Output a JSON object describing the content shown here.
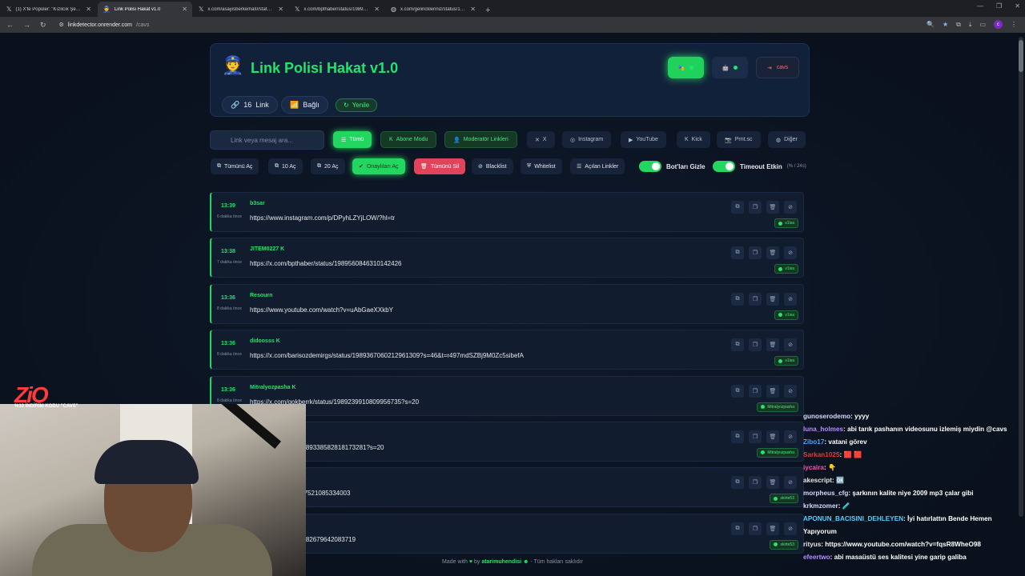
{
  "browser": {
    "tabs": [
      {
        "label": "(1) X'te Popüler: \"Kızılcık Şerbe...",
        "icon": "x-icon",
        "active": false
      },
      {
        "label": "Link Polisi Hakat v1.0",
        "icon": "police-icon",
        "active": true
      },
      {
        "label": "x.com/asayisberkemal0/status/...",
        "icon": "x-icon",
        "active": false
      },
      {
        "label": "x.com/bpthaber/status/198948...",
        "icon": "x-icon",
        "active": false
      },
      {
        "label": "x.com/gelinckleriniz/status/19...",
        "icon": "globe-icon",
        "active": false
      }
    ],
    "url_host": "linkdetector.onrender.com",
    "url_path": "/cavs"
  },
  "header": {
    "title": "Link Polisi Hakat v1.0",
    "link_count": "16",
    "link_label": "Link",
    "status": "Bağlı",
    "refresh": "Yenile",
    "logout": "cavs"
  },
  "search": {
    "placeholder": "Link veya mesaj ara..."
  },
  "filters": [
    {
      "label": "Tümü",
      "style": "on",
      "icon": "list-icon"
    },
    {
      "label": "Abone Modu",
      "style": "gr",
      "icon": "k-icon"
    },
    {
      "label": "Moderatör Linkleri",
      "style": "gr",
      "icon": "user-icon"
    },
    {
      "label": "X",
      "style": "",
      "icon": "x-icon"
    },
    {
      "label": "Instagram",
      "style": "",
      "icon": "instagram-icon"
    },
    {
      "label": "YouTube",
      "style": "",
      "icon": "youtube-icon"
    },
    {
      "label": "Kick",
      "style": "",
      "icon": "kick-icon"
    },
    {
      "label": "Prnt.sc",
      "style": "",
      "icon": "camera-icon"
    },
    {
      "label": "Diğer",
      "style": "",
      "icon": "globe-icon"
    }
  ],
  "actions": [
    {
      "label": "Tümünü Aç",
      "style": "",
      "icon": "open-icon"
    },
    {
      "label": "10 Aç",
      "style": "",
      "icon": "open-icon"
    },
    {
      "label": "20 Aç",
      "style": "",
      "icon": "open-icon"
    },
    {
      "label": "Onaylıları Aç",
      "style": "green",
      "icon": "check-icon"
    },
    {
      "label": "Tümünü Sil",
      "style": "red",
      "icon": "trash-icon"
    },
    {
      "label": "Blacklist",
      "style": "",
      "icon": "ban-icon"
    },
    {
      "label": "Whitelist",
      "style": "",
      "icon": "shield-icon"
    },
    {
      "label": "Açılan Linkler",
      "style": "",
      "icon": "list-icon"
    }
  ],
  "toggles": [
    {
      "label": "Bot'ları Gizle",
      "sub": ""
    },
    {
      "label": "Timeout Etkin",
      "sub": "(% / 24s)"
    }
  ],
  "links": [
    {
      "time": "13:39",
      "ago": "6 dakika önce",
      "user": "b3sar",
      "badge": "",
      "url": "https://www.instagram.com/p/DPyhLZYjLOW/?hl=tr",
      "tag": "v1isa"
    },
    {
      "time": "13:38",
      "ago": "7 dakika önce",
      "user": "JITEM0227",
      "badge": "K",
      "url": "https://x.com/bpthaber/status/1989560846310142426",
      "tag": "v1isa"
    },
    {
      "time": "13:36",
      "ago": "8 dakika önce",
      "user": "Resourn",
      "badge": "",
      "url": "https://www.youtube.com/watch?v=uAbGaeXXkbY",
      "tag": "v1isa"
    },
    {
      "time": "13:36",
      "ago": "8 dakika önce",
      "user": "didoosss",
      "badge": "K",
      "url": "https://x.com/barisozdemirgs/status/1989367060212961309?s=46&t=r497mdSZBj9M0Zc5sibefA",
      "tag": "v1isa"
    },
    {
      "time": "13:36",
      "ago": "8 dakika önce",
      "user": "Mitralyozpasha",
      "badge": "K",
      "url": "https://x.com/gokberrk/status/1989239910809956735?s=20",
      "tag": "Mitralyozpasha"
    },
    {
      "time": "",
      "ago": "",
      "user": "",
      "badge": "",
      "url": "webhaber/status/1989338582818173281?s=20",
      "tag": "Mitralyozpasha"
    },
    {
      "time": "",
      "ago": "",
      "user": "",
      "badge": "",
      "url": "oglu/status/1989587521085334003",
      "tag": "skirte53"
    },
    {
      "time": "",
      "ago": "",
      "user": "",
      "badge": "",
      "url": "icomtr/status/1989582679642083719",
      "tag": "skirte53"
    }
  ],
  "footer": {
    "made": "Made with",
    "by": "by",
    "author": "atarimuhendisi",
    "rights": "- Tüm hakları saklıdır"
  },
  "overlay": {
    "brand": "ZiO",
    "brand_sub": "%10 İNDİRİM KODU \"CAVS\""
  },
  "chat": [
    {
      "name": "gunoserodemo",
      "color": "#d9d9ff",
      "text": ": yyyy"
    },
    {
      "name": "luna_holmes",
      "color": "#b88cff",
      "text": ": abi tarık pashanın videosunu izlemiş miydin @cavs"
    },
    {
      "name": "Zibo17",
      "color": "#4aa3ff",
      "text": ": vatani görev"
    },
    {
      "name": "Sarkan1025",
      "color": "#e23b3b",
      "text": ": 🟥 🟥"
    },
    {
      "name": "iycaira",
      "color": "#ff4fb0",
      "text": ": 👇"
    },
    {
      "name": "akescript",
      "color": "#e6e6e6",
      "text": ": 🆗"
    },
    {
      "name": "morpheus_cfg",
      "color": "#d9d9ff",
      "text": ": şarkının kalite niye 2009 mp3 çalar gibi"
    },
    {
      "name": "krkmzomer",
      "color": "#d9d9ff",
      "text": ": 🧪"
    },
    {
      "name": "APONUN_BACISINI_DEHLEYEN",
      "color": "#4cd1ff",
      "text": ": İyi hatırlattın Bende Hemen Yapıyorum"
    },
    {
      "name": "rityus",
      "color": "#e6e6e6",
      "text": ": https://www.youtube.com/watch?v=fqsR8WheO98"
    },
    {
      "name": "efeertwo",
      "color": "#b88cff",
      "text": ": abi masaüstü ses kalitesi yine garip galiba"
    }
  ]
}
